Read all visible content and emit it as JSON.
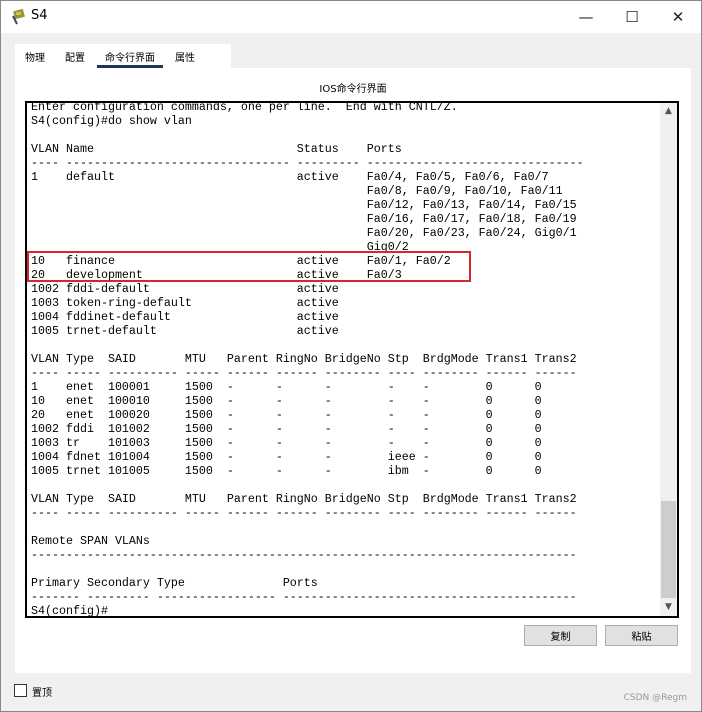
{
  "window": {
    "title": "S4",
    "minimize": "—",
    "maximize": "☐",
    "close": "✕"
  },
  "tabs": [
    {
      "label": "物理"
    },
    {
      "label": "配置"
    },
    {
      "label": "命令行界面",
      "active": true
    },
    {
      "label": "属性"
    }
  ],
  "panel_title": "IOS命令行界面",
  "terminal": {
    "lines": [
      "Enter configuration commands, one per line.  End with CNTL/Z.",
      "S4(config)#do show vlan",
      "",
      "VLAN Name                             Status    Ports",
      "---- -------------------------------- --------- -------------------------------",
      "1    default                          active    Fa0/4, Fa0/5, Fa0/6, Fa0/7",
      "                                                Fa0/8, Fa0/9, Fa0/10, Fa0/11",
      "                                                Fa0/12, Fa0/13, Fa0/14, Fa0/15",
      "                                                Fa0/16, Fa0/17, Fa0/18, Fa0/19",
      "                                                Fa0/20, Fa0/23, Fa0/24, Gig0/1",
      "                                                Gig0/2",
      "10   finance                          active    Fa0/1, Fa0/2",
      "20   development                      active    Fa0/3",
      "1002 fddi-default                     active",
      "1003 token-ring-default               active",
      "1004 fddinet-default                  active",
      "1005 trnet-default                    active",
      "",
      "VLAN Type  SAID       MTU   Parent RingNo BridgeNo Stp  BrdgMode Trans1 Trans2",
      "---- ----- ---------- ----- ------ ------ -------- ---- -------- ------ ------",
      "1    enet  100001     1500  -      -      -        -    -        0      0",
      "10   enet  100010     1500  -      -      -        -    -        0      0",
      "20   enet  100020     1500  -      -      -        -    -        0      0",
      "1002 fddi  101002     1500  -      -      -        -    -        0      0",
      "1003 tr    101003     1500  -      -      -        -    -        0      0",
      "1004 fdnet 101004     1500  -      -      -        ieee -        0      0",
      "1005 trnet 101005     1500  -      -      -        ibm  -        0      0",
      "",
      "VLAN Type  SAID       MTU   Parent RingNo BridgeNo Stp  BrdgMode Trans1 Trans2",
      "---- ----- ---------- ----- ------ ------ -------- ---- -------- ------ ------",
      "",
      "Remote SPAN VLANs",
      "------------------------------------------------------------------------------",
      "",
      "Primary Secondary Type              Ports",
      "------- --------- ----------------- ------------------------------------------",
      "S4(config)#"
    ],
    "highlight_color": "#d9262c"
  },
  "buttons": {
    "copy": "复制",
    "paste": "粘贴"
  },
  "always_on_top": {
    "label": "置顶",
    "checked": false
  },
  "watermark": "CSDN @Regm"
}
